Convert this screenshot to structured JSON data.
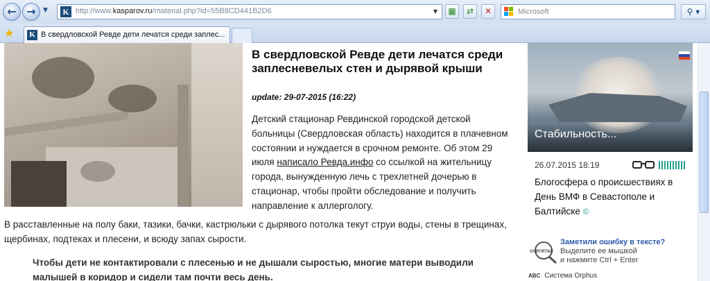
{
  "browser": {
    "url": {
      "prefix": "http://www.",
      "domain": "kasparov.ru",
      "path": "/material.php?id=55B8CD441B2D6"
    },
    "favicon_letter": "K",
    "search_placeholder": "Microsoft",
    "tab_title": "В свердловской Ревде дети лечатся среди заплес...",
    "icons": {
      "back": "back-arrow-icon",
      "forward": "forward-arrow-icon",
      "refresh": "refresh-icon",
      "stop": "stop-icon",
      "search": "magnifier-icon",
      "favorites": "star-icon"
    }
  },
  "article": {
    "title": "В свердловской Ревде дети лечатся среди заплесневелых стен и дырявой крыши",
    "update": "update: 29-07-2015 (16:22)",
    "lead_before_link": "Детский стационар Ревдинской городской детской больницы (Свердловская область) находится в плачевном состоянии и нуждается в срочном ремонте. Об этом 29 июля ",
    "lead_link": "написало Ревда.инфо",
    "lead_after_link": " со ссылкой на жительницу города, вынужденную лечь с трехлетней дочерью в стационар, чтобы пройти обследование и получить направление к аллергологу.",
    "paragraph": "В расставленные на полу баки, тазики, бачки, кастрюльки с дырявого потолка текут струи воды, стены в трещинах, щербинах, подтеках и плесени, и всюду запах сырости.",
    "quote": "Чтобы дети не контактировали с плесенью и не дышали сыростью, многие матери выводили малышей в коридор и сидели там почти весь день."
  },
  "sidebar": {
    "photo_caption": "Стабильность...",
    "date": "26.07.2015 18:19",
    "link_text": "Блогосфера о происшествиях в День ВМФ в Севастополе и Балтийске",
    "comment_marker": "©"
  },
  "orphus": {
    "logo_text": "очепятка",
    "title": "Заметили ошибку в тексте?",
    "line1": "Выделите ее мышкой",
    "line2": "и нажмите Ctrl + Enter",
    "system_abc": "ABC",
    "system": "Система Orphus"
  },
  "colors": {
    "accent_teal": "#1f9f8e",
    "orphus_blue": "#2a5aa8"
  }
}
